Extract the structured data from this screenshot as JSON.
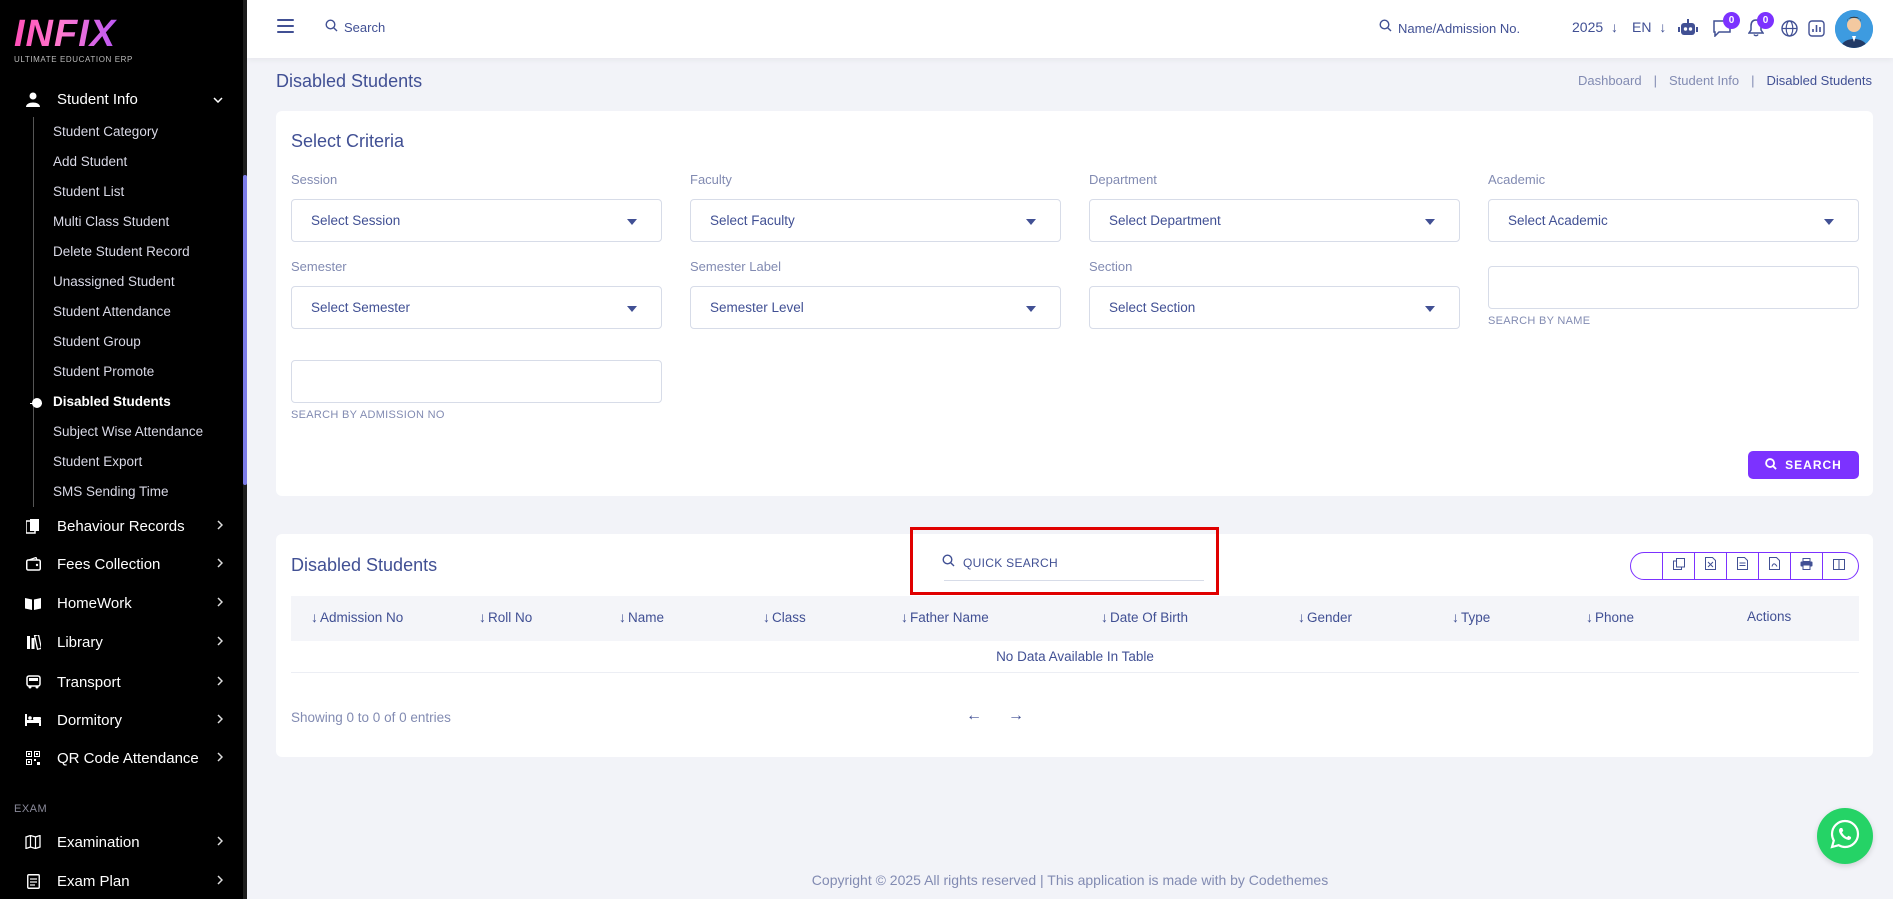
{
  "logo": {
    "brand": "INFIX",
    "tagline": "ULTIMATE EDUCATION ERP"
  },
  "sidebar": {
    "student_info": "Student Info",
    "sub_items": [
      "Student Category",
      "Add Student",
      "Student List",
      "Multi Class Student",
      "Delete Student Record",
      "Unassigned Student",
      "Student Attendance",
      "Student Group",
      "Student Promote",
      "Disabled Students",
      "Subject Wise Attendance",
      "Student Export",
      "SMS Sending Time"
    ],
    "menus": [
      "Behaviour Records",
      "Fees Collection",
      "HomeWork",
      "Library",
      "Transport",
      "Dormitory",
      "QR Code Attendance"
    ],
    "exam_section": "EXAM",
    "exam_menus": [
      "Examination",
      "Exam Plan"
    ]
  },
  "topbar": {
    "search_placeholder": "Search",
    "admission_placeholder": "Name/Admission No.",
    "year": "2025",
    "language": "EN",
    "chat_count": "0",
    "notification_count": "0"
  },
  "page": {
    "title": "Disabled Students",
    "breadcrumb": [
      "Dashboard",
      "|",
      "Student Info",
      "|",
      "Disabled Students"
    ]
  },
  "criteria": {
    "title": "Select Criteria",
    "session_label": "Session",
    "session_value": "Select Session",
    "faculty_label": "Faculty",
    "faculty_value": "Select Faculty",
    "department_label": "Department",
    "department_value": "Select Department",
    "academic_label": "Academic",
    "academic_value": "Select Academic",
    "semester_label": "Semester",
    "semester_value": "Select Semester",
    "semester_level_label": "Semester Label",
    "semester_level_value": "Semester Level",
    "section_label": "Section",
    "section_value": "Select Section",
    "search_by_name": "SEARCH BY NAME",
    "search_by_admission": "SEARCH BY ADMISSION NO",
    "search_button": "SEARCH"
  },
  "table": {
    "title": "Disabled Students",
    "quick_search_placeholder": "QUICK SEARCH",
    "columns": [
      "Admission No",
      "Roll No",
      "Name",
      "Class",
      "Father Name",
      "Date Of Birth",
      "Gender",
      "Type",
      "Phone",
      "Actions"
    ],
    "empty_text": "No Data Available In Table",
    "showing": "Showing 0 to 0 of 0 entries"
  },
  "footer": "Copyright © 2025 All rights reserved | This application is made with by Codethemes",
  "colors": {
    "accent": "#7c32ff",
    "text": "#415094",
    "muted": "#828bb2",
    "highlight": "#e00000",
    "whatsapp": "#25d366"
  }
}
